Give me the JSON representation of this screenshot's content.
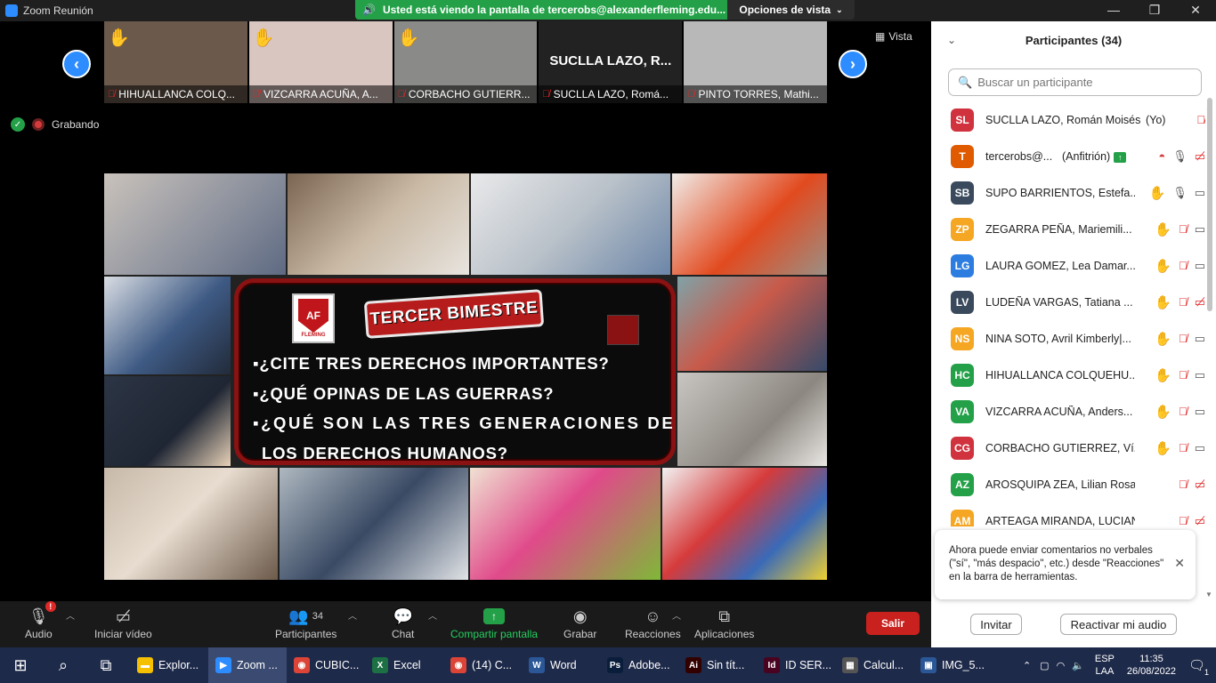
{
  "window": {
    "title": "Zoom Reunión",
    "share_banner": "Usted está viendo la pantalla de tercerobs@alexanderfleming.edu...",
    "view_options": "Opciones de vista",
    "view_button": "Vista"
  },
  "thumbnails": [
    {
      "name": "HIHUALLANCA COLQ...",
      "hand": true,
      "bg": "#6b5a4c"
    },
    {
      "name": "VIZCARRA ACUÑA, A...",
      "hand": true,
      "bg": "#d9c6c0"
    },
    {
      "name": "CORBACHO GUTIERR...",
      "hand": true,
      "bg": "#8a8a88"
    },
    {
      "name": "SUCLLA LAZO, Romá...",
      "hand": false,
      "bg": "#222222",
      "big_label": "SUCLLA LAZO, R..."
    },
    {
      "name": "PINTO TORRES, Mathi...",
      "hand": false,
      "bg": "#b8b8b8"
    }
  ],
  "status": {
    "recording": "Grabando"
  },
  "slide": {
    "logo_text": "FLEMING",
    "logo_letters": "AF",
    "banner": "TERCER BIMESTRE",
    "questions": [
      "▪¿CITE TRES DERECHOS IMPORTANTES?",
      "▪¿QUÉ OPINAS DE LAS GUERRAS?",
      "▪¿QUÉ SON LAS TRES GENERACIONES DE",
      "LOS DERECHOS HUMANOS?"
    ]
  },
  "toolbar": {
    "audio": "Audio",
    "audio_badge": "!",
    "video": "Iniciar vídeo",
    "participants": "Participantes",
    "participants_count": "34",
    "chat": "Chat",
    "share": "Compartir pantalla",
    "record": "Grabar",
    "reactions": "Reacciones",
    "apps": "Aplicaciones",
    "leave": "Salir"
  },
  "panel": {
    "title": "Participantes (34)",
    "search_placeholder": "Buscar un participante",
    "participants": [
      {
        "initials": "SL",
        "color": "#d0323e",
        "name": "SUCLLA LAZO, Román Moisés|...",
        "tag": "(Yo)",
        "hand": false,
        "mic": "off",
        "video": "none"
      },
      {
        "initials": "T",
        "color": "#e05a00",
        "name": "tercerobs@...",
        "tag": "(Anfitrión)",
        "hand": false,
        "mic": "on",
        "video": "off"
      },
      {
        "initials": "SB",
        "color": "#3a4a5c",
        "name": "SUPO BARRIENTOS, Estefa...",
        "tag": "",
        "hand": true,
        "mic": "on",
        "video": "on"
      },
      {
        "initials": "ZP",
        "color": "#f5a623",
        "name": "ZEGARRA PEÑA, Mariemili...",
        "tag": "",
        "hand": true,
        "mic": "off",
        "video": "on"
      },
      {
        "initials": "LG",
        "color": "#2d7de0",
        "name": "LAURA GOMEZ, Lea Damar...",
        "tag": "",
        "hand": true,
        "mic": "off",
        "video": "on"
      },
      {
        "initials": "LV",
        "color": "#3a4a5c",
        "name": "LUDEÑA VARGAS, Tatiana ...",
        "tag": "",
        "hand": true,
        "mic": "off",
        "video": "off"
      },
      {
        "initials": "NS",
        "color": "#f5a623",
        "name": "NINA SOTO, Avril Kimberly|...",
        "tag": "",
        "hand": true,
        "mic": "off",
        "video": "on"
      },
      {
        "initials": "HC",
        "color": "#24a148",
        "name": "HIHUALLANCA COLQUEHU...",
        "tag": "",
        "hand": true,
        "mic": "off",
        "video": "on"
      },
      {
        "initials": "VA",
        "color": "#24a148",
        "name": "VIZCARRA ACUÑA, Anders...",
        "tag": "",
        "hand": true,
        "mic": "off",
        "video": "on"
      },
      {
        "initials": "CG",
        "color": "#d0323e",
        "name": "CORBACHO GUTIERREZ, Ví...",
        "tag": "",
        "hand": true,
        "mic": "off",
        "video": "on"
      },
      {
        "initials": "AZ",
        "color": "#24a148",
        "name": "AROSQUIPA ZEA, Lilian Rosario...",
        "tag": "",
        "hand": false,
        "mic": "off",
        "video": "off"
      },
      {
        "initials": "AM",
        "color": "#f5a623",
        "name": "ARTEAGA MIRANDA, LUCIANA ...",
        "tag": "",
        "hand": false,
        "mic": "off",
        "video": "off"
      }
    ],
    "toast": "Ahora puede enviar comentarios no verbales (\"sí\", \"más despacio\", etc.) desde \"Reacciones\" en la barra de herramientas.",
    "invite": "Invitar",
    "unmute": "Reactivar mi audio"
  },
  "taskbar": {
    "apps": [
      {
        "label": "Explor...",
        "color": "#f5c000",
        "glyph": "▬"
      },
      {
        "label": "Zoom ...",
        "color": "#2d8cff",
        "glyph": "▶",
        "active": true
      },
      {
        "label": "CUBIC...",
        "color": "#db4437",
        "glyph": "◉"
      },
      {
        "label": "Excel",
        "color": "#1d7044",
        "glyph": "X"
      },
      {
        "label": "(14) C...",
        "color": "#db4437",
        "glyph": "◉"
      },
      {
        "label": "Word",
        "color": "#2b5797",
        "glyph": "W"
      },
      {
        "label": "Adobe...",
        "color": "#0a1e3c",
        "glyph": "Ps"
      },
      {
        "label": "Sin tít...",
        "color": "#330000",
        "glyph": "Ai"
      },
      {
        "label": "ID SER...",
        "color": "#49021f",
        "glyph": "Id"
      },
      {
        "label": "Calcul...",
        "color": "#555555",
        "glyph": "▦"
      },
      {
        "label": "IMG_5...",
        "color": "#2b5797",
        "glyph": "▣"
      }
    ],
    "lang_top": "ESP",
    "lang_bottom": "LAA",
    "time": "11:35",
    "date": "26/08/2022",
    "notif_count": "1"
  }
}
